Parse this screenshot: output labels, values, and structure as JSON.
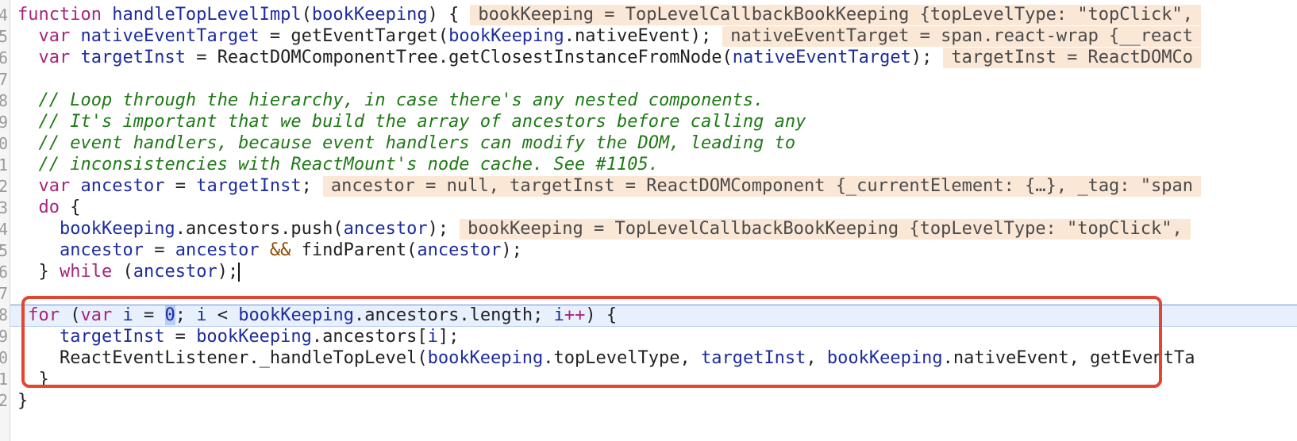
{
  "line_numbers": [
    "4",
    "5",
    "6",
    "7",
    "8",
    "9",
    "0",
    "1",
    "2",
    "3",
    "4",
    "5",
    "6",
    "7",
    "8",
    "9",
    "0",
    "1",
    "2"
  ],
  "code": {
    "l1_kw": "function",
    "l1_name": "handleTopLevelImpl",
    "l1_param": "bookKeeping",
    "l1_tail": ") {",
    "l1_val": "bookKeeping = TopLevelCallbackBookKeeping {topLevelType: \"topClick\",",
    "l2_kw": "var",
    "l2_var": "nativeEventTarget",
    "l2_mid": " = getEventTarget(",
    "l2_ref": "bookKeeping",
    "l2_tail": ".nativeEvent);",
    "l2_val": "nativeEventTarget = span.react-wrap {__react",
    "l3_kw": "var",
    "l3_var": "targetInst",
    "l3_mid": " = ReactDOMComponentTree.getClosestInstanceFromNode(",
    "l3_ref": "nativeEventTarget",
    "l3_tail": ");",
    "l3_val": "targetInst = ReactDOMCo",
    "c1": "// Loop through the hierarchy, in case there's any nested components.",
    "c2": "// It's important that we build the array of ancestors before calling any",
    "c3": "// event handlers, because event handlers can modify the DOM, leading to",
    "c4": "// inconsistencies with ReactMount's node cache. See #1105.",
    "l9_kw": "var",
    "l9_var": "ancestor",
    "l9_mid": " = ",
    "l9_ref": "targetInst",
    "l9_tail": ";",
    "l9_val": "ancestor = null, targetInst = ReactDOMComponent {_currentElement: {…}, _tag: \"span",
    "l10_kw": "do",
    "l10_tail": " {",
    "l11_ref": "bookKeeping",
    "l11_mid": ".ancestors.push(",
    "l11_ref2": "ancestor",
    "l11_tail": ");",
    "l11_val": "bookKeeping = TopLevelCallbackBookKeeping {topLevelType: \"topClick\",",
    "l12_ref": "ancestor",
    "l12_mid": " = ",
    "l12_ref2": "ancestor",
    "l12_amp": "&&",
    "l12_mid2": " findParent(",
    "l12_ref3": "ancestor",
    "l12_tail": ");",
    "l13_head": "} ",
    "l13_kw": "while",
    "l13_mid": " (",
    "l13_ref": "ancestor",
    "l13_tail": ");",
    "l15_kw": "for",
    "l15_p1": " (",
    "l15_kw2": "var",
    "l15_i": "i",
    "l15_eq": " = ",
    "l15_num": "0",
    "l15_p2": "; ",
    "l15_i2": "i",
    "l15_lt": " < ",
    "l15_ref": "bookKeeping",
    "l15_p3": ".ancestors.length; ",
    "l15_i3": "i",
    "l15_inc": "++",
    "l15_tail": ") {",
    "l16_ref": "targetInst",
    "l16_mid": " = ",
    "l16_ref2": "bookKeeping",
    "l16_mid2": ".ancestors[",
    "l16_i": "i",
    "l16_tail": "];",
    "l17_head": "ReactEventListener._handleTopLevel(",
    "l17_ref": "bookKeeping",
    "l17_mid": ".topLevelType, ",
    "l17_ref2": "targetInst",
    "l17_mid2": ", ",
    "l17_ref3": "bookKeeping",
    "l17_tail": ".nativeEvent, getEventTa",
    "l18": "}",
    "l19": "}"
  },
  "colors": {
    "keyword": "#a7247a",
    "variable": "#1d2c9e",
    "comment": "#1f7a16",
    "inline_value_bg": "#fbe7d6",
    "highlight_box": "#e2462e",
    "current_line_bg": "#e8f0fe"
  }
}
